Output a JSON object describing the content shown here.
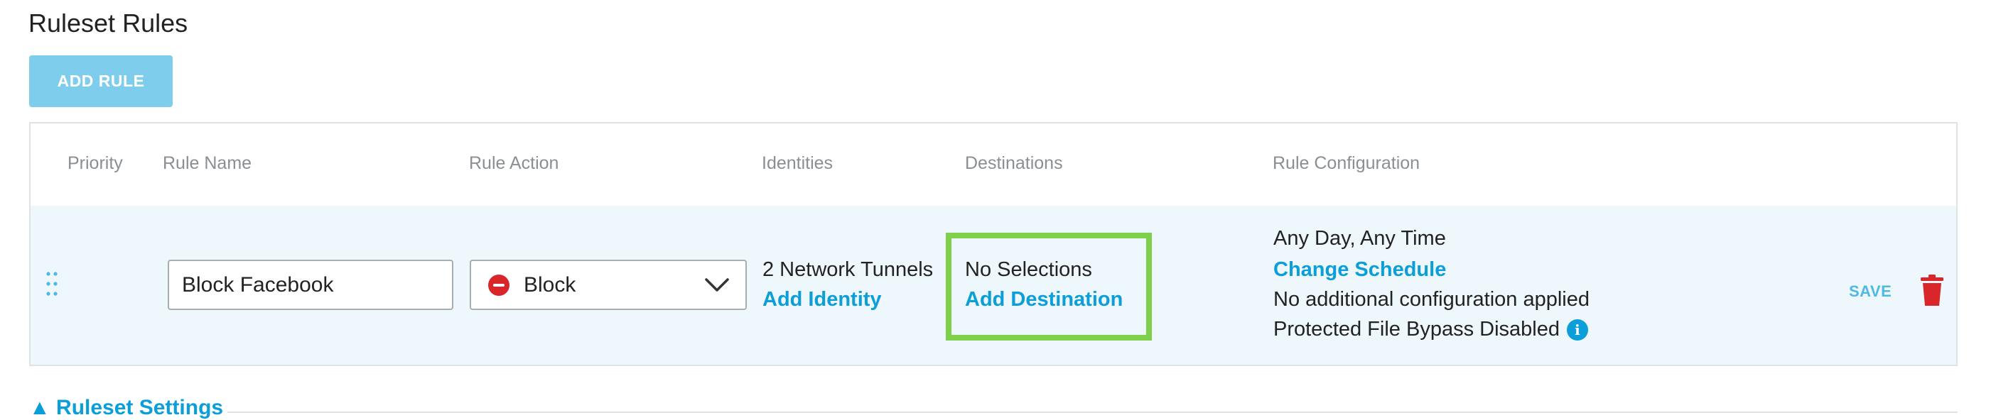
{
  "page": {
    "title": "Ruleset Rules"
  },
  "toolbar": {
    "add_rule_label": "ADD RULE"
  },
  "table": {
    "headers": [
      "Priority",
      "Rule Name",
      "Rule Action",
      "Identities",
      "Destinations",
      "Rule Configuration"
    ],
    "rows": [
      {
        "rule_name": "Block Facebook",
        "rule_action": "Block",
        "identities": {
          "text": "2 Network Tunnels",
          "link": "Add Identity"
        },
        "destinations": {
          "text": "No Selections",
          "link": "Add Destination"
        },
        "config": {
          "schedule": "Any Day, Any Time",
          "schedule_link": "Change Schedule",
          "additional": "No additional configuration applied",
          "bypass": "Protected File Bypass Disabled"
        },
        "save_label": "SAVE"
      }
    ]
  },
  "footer": {
    "settings_label": "▲  Ruleset Settings"
  },
  "colors": {
    "accent": "#0b9ed8",
    "button": "#7fcdec",
    "highlight": "#7ed04b",
    "danger": "#d9262b"
  }
}
